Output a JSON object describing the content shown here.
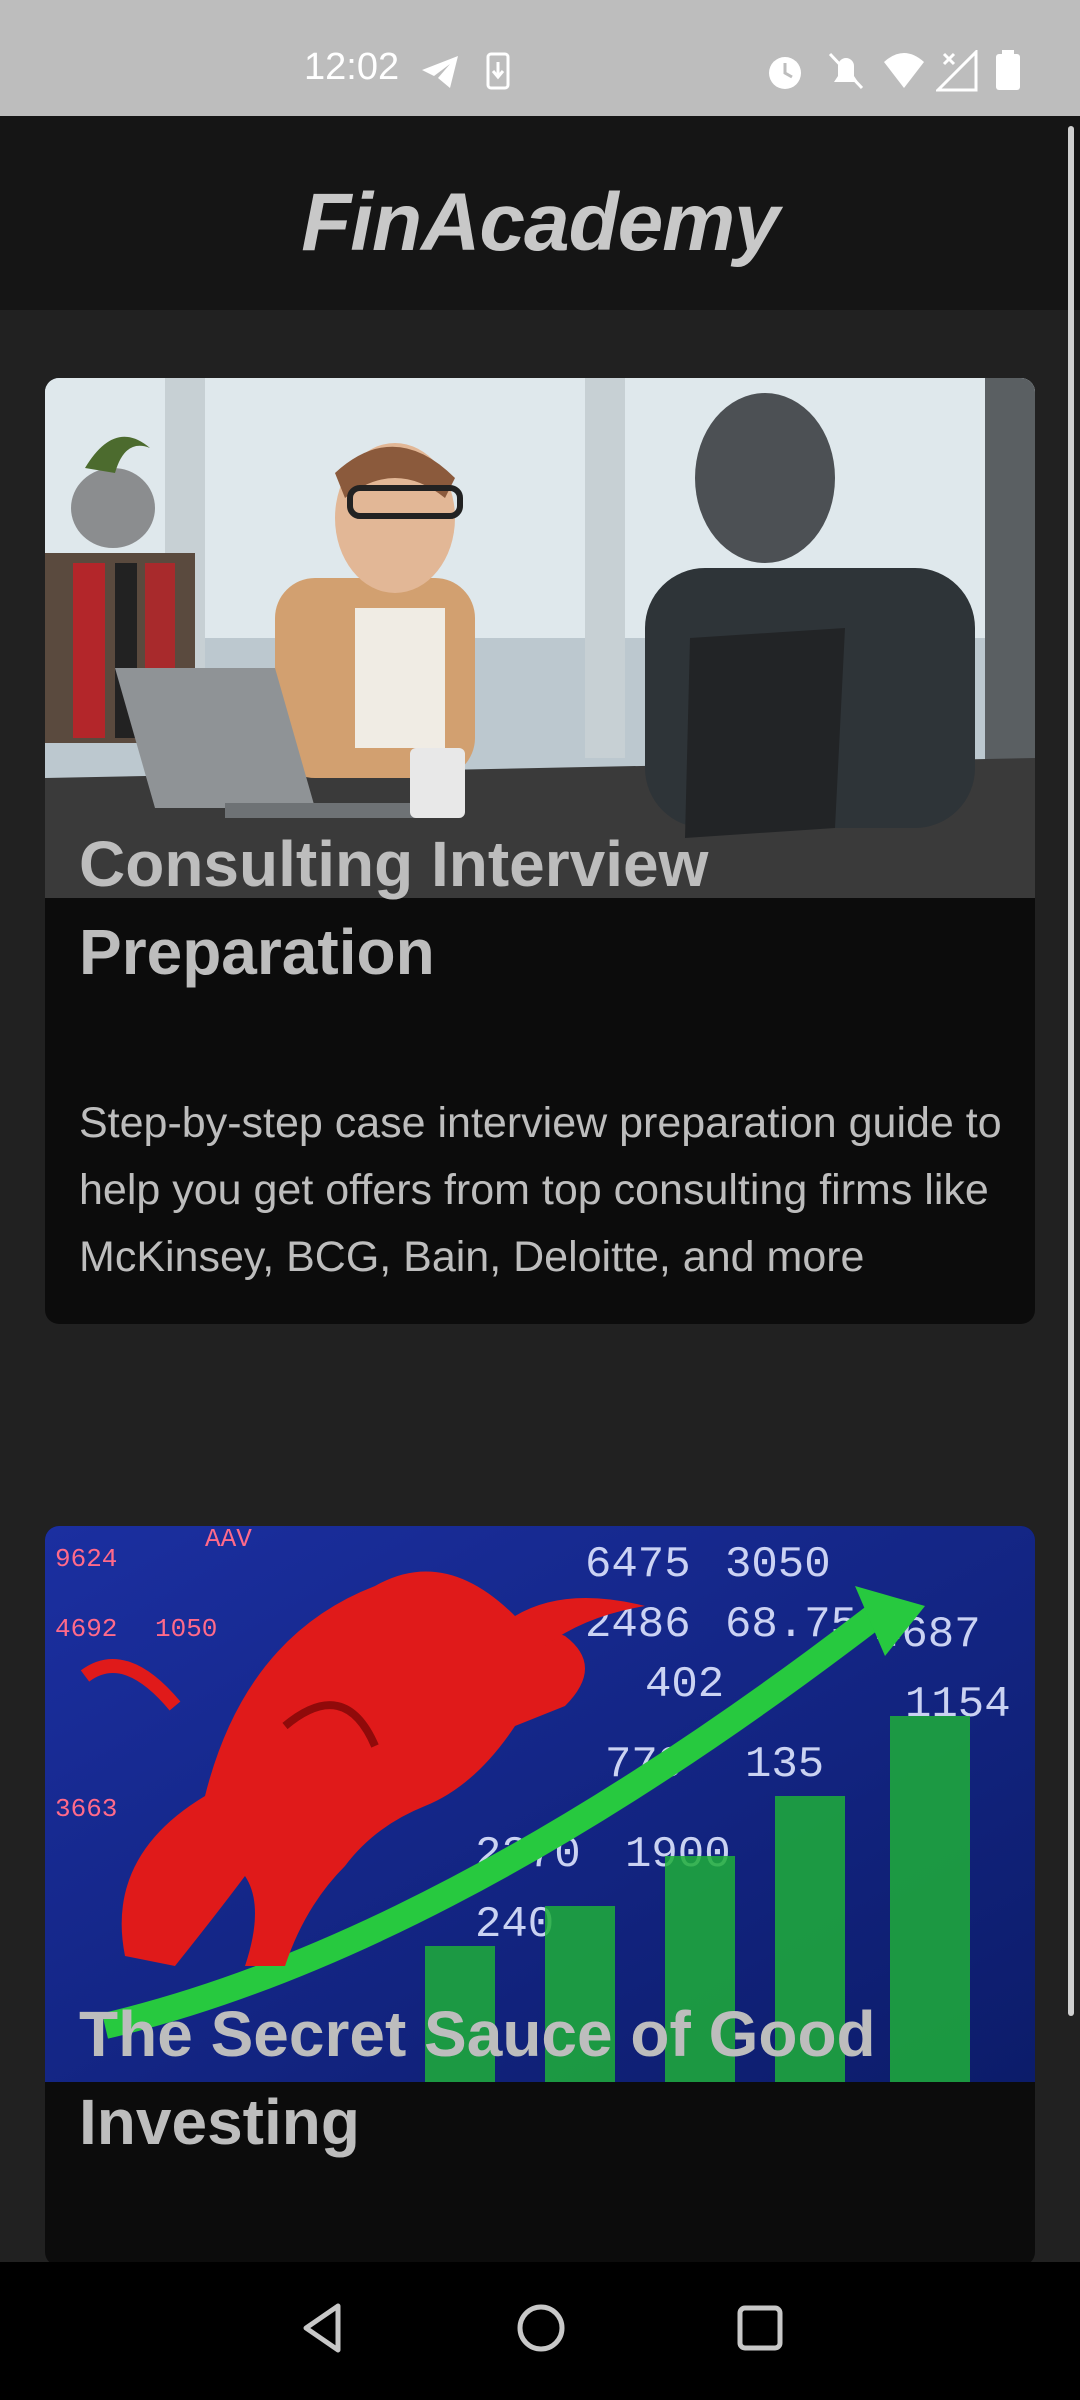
{
  "status_bar": {
    "time": "12:02",
    "icons": [
      "telegram-icon",
      "download-icon",
      "alarm-icon",
      "bell-off-icon",
      "wifi-icon",
      "no-signal-icon",
      "battery-icon"
    ]
  },
  "header": {
    "title": "FinAcademy"
  },
  "cards": [
    {
      "title": "Consulting Interview Preparation",
      "description": "Step-by-step case interview preparation guide to help you get offers from top consulting firms like McKinsey, BCG, Bain, Deloitte, and more",
      "image": "office-meeting-photo"
    },
    {
      "title": "The Secret Sauce of Good Investing",
      "image": "bull-stock-market-photo"
    }
  ],
  "nav_bar": {
    "buttons": [
      "back-icon",
      "home-icon",
      "recents-icon"
    ]
  },
  "colors": {
    "background": "#212121",
    "header_bg": "#151515",
    "card_bg": "#0c0c0c",
    "text": "#bdbdbd"
  }
}
